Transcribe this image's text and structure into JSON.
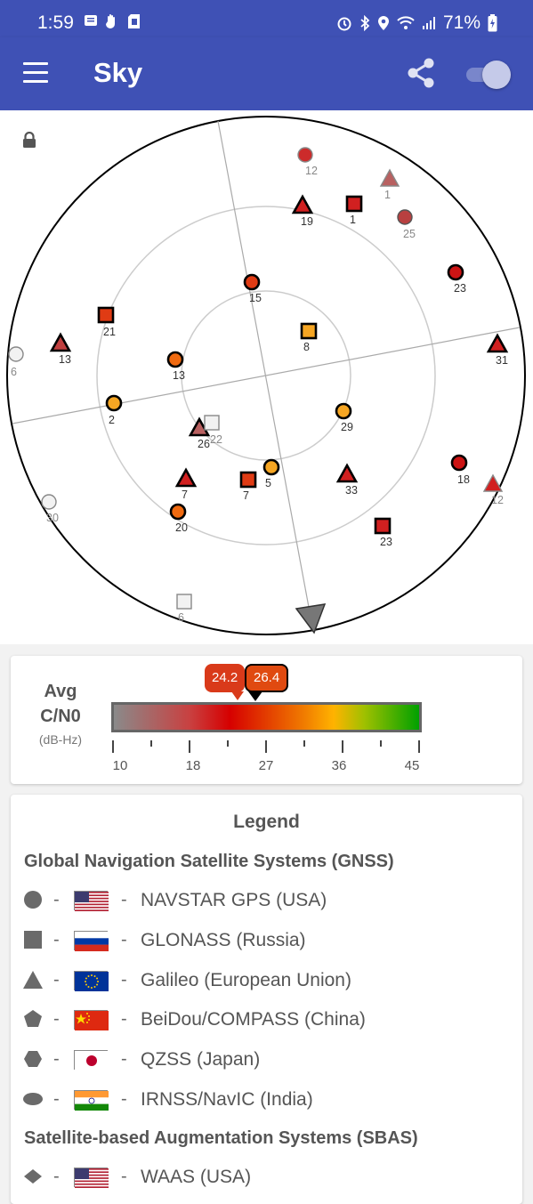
{
  "status_bar": {
    "time": "1:59",
    "battery": "71%",
    "icons": [
      "message-icon",
      "hand-icon",
      "sim-card-icon",
      "alarm-icon",
      "bluetooth-icon",
      "location-icon",
      "wifi-icon",
      "signal-icon",
      "battery-icon"
    ]
  },
  "app_bar": {
    "title": "Sky",
    "icons": [
      "menu-icon",
      "share-icon",
      "toggle-switch"
    ]
  },
  "colors": {
    "primary": "#3f51b5",
    "gps": "#cc3333",
    "strong": "#f6a623"
  },
  "sky_plot": {
    "satellites": [
      {
        "label": "12",
        "shape": "circle",
        "fill": "#cc2b2b",
        "outline": "#888"
      },
      {
        "label": "1",
        "shape": "triangle",
        "fill": "#b86060",
        "outline": "#888"
      },
      {
        "label": "19",
        "shape": "triangle",
        "fill": "#d12020",
        "outline": "#000"
      },
      {
        "label": "1",
        "shape": "square",
        "fill": "#d12020",
        "outline": "#000"
      },
      {
        "label": "25",
        "shape": "circle",
        "fill": "#b84040",
        "outline": "#555"
      },
      {
        "label": "23",
        "shape": "circle",
        "fill": "#cc1414",
        "outline": "#000"
      },
      {
        "label": "15",
        "shape": "circle",
        "fill": "#e03b14",
        "outline": "#000"
      },
      {
        "label": "21",
        "shape": "square",
        "fill": "#e03b14",
        "outline": "#000"
      },
      {
        "label": "8",
        "shape": "square",
        "fill": "#f6a623",
        "outline": "#000"
      },
      {
        "label": "13",
        "shape": "triangle",
        "fill": "#c04040",
        "outline": "#000"
      },
      {
        "label": "13",
        "shape": "circle",
        "fill": "#f06a10",
        "outline": "#000"
      },
      {
        "label": "31",
        "shape": "triangle",
        "fill": "#d12020",
        "outline": "#000"
      },
      {
        "label": "6",
        "shape": "circle",
        "fill": "#f2f2f2",
        "outline": "#888"
      },
      {
        "label": "2",
        "shape": "circle",
        "fill": "#f6a623",
        "outline": "#000"
      },
      {
        "label": "29",
        "shape": "circle",
        "fill": "#f6a623",
        "outline": "#000"
      },
      {
        "label": "26",
        "shape": "triangle",
        "fill": "#b86060",
        "outline": "#000"
      },
      {
        "label": "22",
        "shape": "square",
        "fill": "#f2f2f2",
        "outline": "#888"
      },
      {
        "label": "5",
        "shape": "circle",
        "fill": "#f6a623",
        "outline": "#000"
      },
      {
        "label": "7",
        "shape": "triangle",
        "fill": "#d12020",
        "outline": "#000"
      },
      {
        "label": "7",
        "shape": "square",
        "fill": "#e03b14",
        "outline": "#000"
      },
      {
        "label": "33",
        "shape": "triangle",
        "fill": "#d12020",
        "outline": "#000"
      },
      {
        "label": "18",
        "shape": "circle",
        "fill": "#cc1414",
        "outline": "#000"
      },
      {
        "label": "12",
        "shape": "triangle",
        "fill": "#d12020",
        "outline": "#888"
      },
      {
        "label": "30",
        "shape": "circle",
        "fill": "#f2f2f2",
        "outline": "#888"
      },
      {
        "label": "20",
        "shape": "circle",
        "fill": "#f06a10",
        "outline": "#000"
      },
      {
        "label": "23",
        "shape": "square",
        "fill": "#d12020",
        "outline": "#000"
      },
      {
        "label": "6",
        "shape": "square",
        "fill": "#f2f2f2",
        "outline": "#888"
      }
    ]
  },
  "cn0": {
    "title": "Avg C/N0",
    "units": "(dB-Hz)",
    "value_a": "24.2",
    "value_b": "26.4",
    "ticks": [
      "10",
      "18",
      "27",
      "36",
      "45"
    ]
  },
  "legend": {
    "title": "Legend",
    "gnss_heading": "Global Navigation Satellite Systems (GNSS)",
    "sbas_heading": "Satellite-based Augmentation Systems (SBAS)",
    "dash": "-",
    "gnss_items": [
      {
        "shape": "circle",
        "flag": "usa",
        "name": "NAVSTAR GPS (USA)"
      },
      {
        "shape": "square",
        "flag": "russia",
        "name": "GLONASS (Russia)"
      },
      {
        "shape": "triangle",
        "flag": "eu",
        "name": "Galileo (European Union)"
      },
      {
        "shape": "pentagon",
        "flag": "china",
        "name": "BeiDou/COMPASS (China)"
      },
      {
        "shape": "hexagon",
        "flag": "japan",
        "name": "QZSS (Japan)"
      },
      {
        "shape": "oval",
        "flag": "india",
        "name": "IRNSS/NavIC (India)"
      }
    ],
    "sbas_items": [
      {
        "shape": "diamond",
        "flag": "usa",
        "name": "WAAS (USA)"
      }
    ]
  }
}
